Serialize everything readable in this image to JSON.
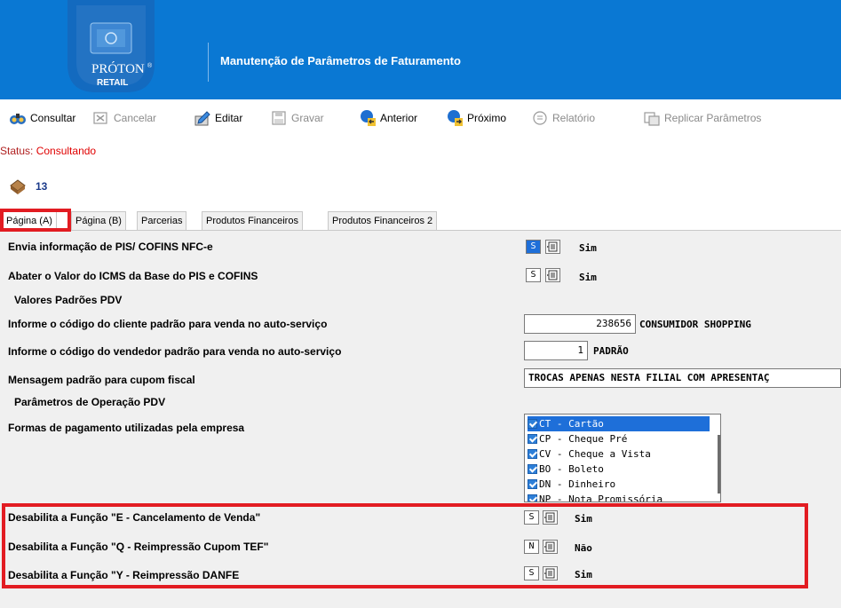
{
  "header": {
    "logo_line1": "PRÓTON",
    "logo_line2": "RETAIL",
    "logo_reg": "®",
    "title": "Manutenção de Parâmetros de Faturamento"
  },
  "toolbar": {
    "consultar": "Consultar",
    "cancelar": "Cancelar",
    "editar": "Editar",
    "gravar": "Gravar",
    "anterior": "Anterior",
    "proximo": "Próximo",
    "relatorio": "Relatório",
    "replicar": "Replicar Parâmetros"
  },
  "status": {
    "label": "Status:",
    "value": "Consultando"
  },
  "record": {
    "id": "13"
  },
  "tabs": [
    "Página (A)",
    "Página (B)",
    "Parcerias",
    "Produtos Financeiros",
    "Produtos Financeiros 2"
  ],
  "fields": {
    "pis_nfce": {
      "label": "Envia informação de PIS/ COFINS NFC-e",
      "code": "S",
      "value": "Sim"
    },
    "icms": {
      "label": "Abater o Valor do ICMS da Base do PIS e COFINS",
      "code": "S",
      "value": "Sim"
    },
    "section_pdv": "Valores Padrões PDV",
    "cliente": {
      "label": "Informe o código do cliente padrão para venda no auto-serviço",
      "code": "238656",
      "value": "CONSUMIDOR SHOPPING"
    },
    "vendedor": {
      "label": "Informe o código do vendedor padrão para venda no auto-serviço",
      "code": "1",
      "value": "PADRÃO"
    },
    "mensagem": {
      "label": "Mensagem padrão para cupom fiscal",
      "value": "TROCAS APENAS NESTA FILIAL COM APRESENTAÇ"
    },
    "section_operacao": "Parâmetros de Operação PDV",
    "formas": {
      "label": "Formas de pagamento utilizadas pela empresa",
      "items": [
        "CT - Cartão",
        "CP - Cheque Pré",
        "CV - Cheque a Vista",
        "BO - Boleto",
        "DN - Dinheiro",
        "NP - Nota Promissória"
      ]
    },
    "func_e": {
      "label": "Desabilita a Função \"E - Cancelamento de Venda\"",
      "code": "S",
      "value": "Sim"
    },
    "func_q": {
      "label": "Desabilita a Função \"Q - Reimpressão Cupom TEF\"",
      "code": "N",
      "value": "Não"
    },
    "func_y": {
      "label": "Desabilita a Função \"Y - Reimpressão DANFE",
      "code": "S",
      "value": "Sim"
    }
  },
  "colors": {
    "header_blue": "#0a78d3",
    "highlight_red": "#e21c22",
    "status_red": "#e00000",
    "selection_blue": "#1e6fd9"
  },
  "icons": [
    "binoculars-icon",
    "cancel-icon",
    "edit-icon",
    "save-icon",
    "arrow-left-icon",
    "arrow-right-icon",
    "report-icon",
    "replicate-icon",
    "record-icon",
    "lookup-list-icon"
  ]
}
